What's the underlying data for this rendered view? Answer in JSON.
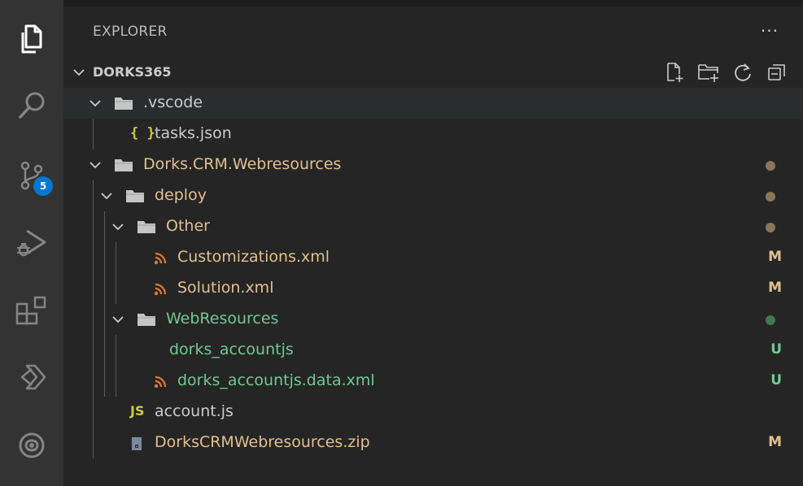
{
  "activity_bar": {
    "items": [
      {
        "icon": "files-icon",
        "active": true
      },
      {
        "icon": "search-icon"
      },
      {
        "icon": "source-control-icon",
        "badge": "5"
      },
      {
        "icon": "run-debug-icon"
      },
      {
        "icon": "extensions-icon"
      },
      {
        "icon": "power-platform-icon"
      },
      {
        "icon": "dataverse-icon"
      }
    ]
  },
  "explorer": {
    "title": "EXPLORER",
    "more_actions": "···",
    "section_title": "DORKS365",
    "actions": [
      "new-file-icon",
      "new-folder-icon",
      "refresh-icon",
      "collapse-all-icon"
    ]
  },
  "tree": [
    {
      "label": ".vscode",
      "type": "folder",
      "depth": 0,
      "expanded": true,
      "selected": true,
      "color": "default",
      "status": ""
    },
    {
      "label": "tasks.json",
      "type": "json",
      "depth": 1,
      "color": "default",
      "status": ""
    },
    {
      "label": "Dorks.CRM.Webresources",
      "type": "folder",
      "depth": 0,
      "expanded": true,
      "color": "mod",
      "status": "dot"
    },
    {
      "label": "deploy",
      "type": "folder",
      "depth": 1,
      "expanded": true,
      "color": "mod",
      "status": "dot"
    },
    {
      "label": "Other",
      "type": "folder",
      "depth": 2,
      "expanded": true,
      "color": "mod",
      "status": "dot"
    },
    {
      "label": "Customizations.xml",
      "type": "xml",
      "depth": 3,
      "color": "mod",
      "status": "M"
    },
    {
      "label": "Solution.xml",
      "type": "xml",
      "depth": 3,
      "color": "mod",
      "status": "M"
    },
    {
      "label": "WebResources",
      "type": "folder",
      "depth": 2,
      "expanded": true,
      "color": "new",
      "status": "dot"
    },
    {
      "label": "dorks_accountjs",
      "type": "none",
      "depth": 3,
      "color": "new",
      "status": "U"
    },
    {
      "label": "dorks_accountjs.data.xml",
      "type": "xml",
      "depth": 3,
      "color": "new",
      "status": "U"
    },
    {
      "label": "account.js",
      "type": "js",
      "depth": 1,
      "color": "default",
      "status": ""
    },
    {
      "label": "DorksCRMWebresources.zip",
      "type": "zip",
      "depth": 1,
      "color": "mod",
      "status": "M"
    }
  ],
  "colors": {
    "modified": "#e2c08d",
    "untracked": "#73c991",
    "folder_dot_modified": "#8a7558",
    "folder_dot_untracked": "#3f7a52",
    "badge": "#0078d4"
  }
}
